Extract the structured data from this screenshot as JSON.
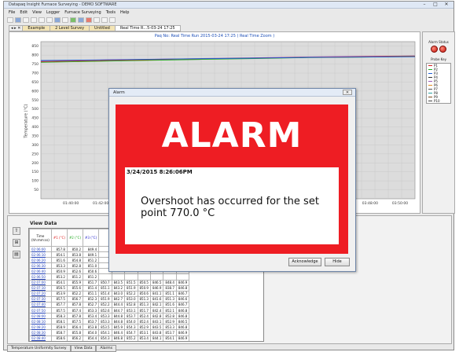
{
  "window": {
    "title": "Datapaq Insight Furnace Surveying - DEMO SOFTWARE",
    "minimize": "–",
    "maximize": "□",
    "close": "✕"
  },
  "menu": [
    "File",
    "Edit",
    "View",
    "Logger",
    "Furnace Surveying",
    "Tools",
    "Help"
  ],
  "tabs": {
    "nav": "◂ ▸ ✕",
    "items": [
      "Example",
      "2 Level Survey",
      "Untitled",
      "Real Time R...5-03-24 17:25"
    ]
  },
  "chart": {
    "title": "Paq No: Real Time Run 2015-03-24 17:25 ( Real Time Zoom )",
    "ylabel": "Temperature (°C)",
    "y_ticks": [
      "850",
      "800",
      "750",
      "700",
      "650",
      "600",
      "550",
      "500",
      "450",
      "400",
      "350",
      "300",
      "250",
      "200",
      "150",
      "100",
      "50"
    ],
    "x_ticks": [
      "01:40:00",
      "01:42:00",
      "01:44:00",
      "03:48:00",
      "03:50:00"
    ]
  },
  "chart_data": {
    "type": "line",
    "ylabel": "Temperature (°C)",
    "ylim": [
      0,
      875
    ],
    "grid": true,
    "series": [
      {
        "color": "#9b59b6",
        "values": [
          768,
          772,
          776,
          781,
          785,
          790,
          793,
          796
        ]
      },
      {
        "color": "#d22222",
        "values": [
          764,
          769,
          774,
          779,
          784,
          788,
          791,
          794
        ]
      },
      {
        "color": "#22aa22",
        "values": [
          760,
          765,
          771,
          776,
          781,
          786,
          789,
          792
        ]
      },
      {
        "color": "#1f5fd6",
        "values": [
          770,
          773,
          777,
          780,
          783,
          787,
          789,
          791
        ]
      }
    ]
  },
  "right_panel": {
    "alarm_status": "Alarm Status",
    "probe_key_title": "Probe Key",
    "probes": [
      "P1",
      "P2",
      "P3",
      "P4",
      "P5",
      "P6",
      "P7",
      "P8",
      "P9",
      "P10"
    ],
    "colors": [
      "#d22222",
      "#22aa22",
      "#1f5fd6",
      "#333333",
      "#9b59b6",
      "#e08a1e",
      "#555555",
      "#2aa0a0",
      "#7a4a20",
      "#444444"
    ]
  },
  "view_data": {
    "title": "View Data",
    "side_tools": [
      "⇧",
      "⊞",
      "▤"
    ],
    "headers": [
      "Time\n(hh:mm:ss)",
      "#1 (°C)",
      "#2 (°C)",
      "#3 (°C)"
    ],
    "rows": [
      [
        "02:06:00",
        "857.8",
        "850.2",
        "849.4",
        "",
        "",
        "",
        "",
        "",
        "",
        ""
      ],
      [
        "02:06:10",
        "854.1",
        "853.8",
        "849.1",
        "",
        "",
        "",
        "",
        "",
        "",
        ""
      ],
      [
        "02:06:20",
        "851.6",
        "854.8",
        "851.2",
        "",
        "",
        "",
        "",
        "",
        "",
        ""
      ],
      [
        "02:06:30",
        "853.3",
        "852.8",
        "851.0",
        "",
        "",
        "",
        "",
        "",
        "",
        ""
      ],
      [
        "02:06:40",
        "850.9",
        "852.6",
        "850.6",
        "",
        "",
        "",
        "",
        "",
        "",
        ""
      ],
      [
        "02:06:50",
        "853.2",
        "851.2",
        "851.2",
        "",
        "",
        "",
        "",
        "",
        "",
        ""
      ],
      [
        "02:07:00",
        "854.1",
        "855.9",
        "851.7",
        "850.7",
        "843.5",
        "851.5",
        "850.5",
        "846.5",
        "848.4",
        "846.9"
      ],
      [
        "02:07:10",
        "856.5",
        "855.6",
        "851.4",
        "851.1",
        "843.2",
        "851.9",
        "850.9",
        "846.9",
        "838.7",
        "846.8"
      ],
      [
        "02:07:20",
        "853.9",
        "852.2",
        "851.1",
        "851.4",
        "843.0",
        "852.2",
        "850.6",
        "841.1",
        "851.1",
        "846.7"
      ],
      [
        "02:07:30",
        "857.5",
        "856.7",
        "852.3",
        "851.9",
        "842.7",
        "853.0",
        "851.3",
        "841.6",
        "851.3",
        "846.6"
      ],
      [
        "02:07:40",
        "857.7",
        "857.8",
        "852.7",
        "852.2",
        "844.4",
        "852.8",
        "851.3",
        "842.1",
        "851.6",
        "846.7"
      ],
      [
        "02:07:50",
        "857.5",
        "857.4",
        "853.3",
        "852.6",
        "844.7",
        "853.1",
        "851.7",
        "842.4",
        "852.1",
        "846.8"
      ],
      [
        "02:08:00",
        "858.3",
        "857.8",
        "853.4",
        "853.3",
        "844.8",
        "853.7",
        "852.4",
        "842.8",
        "852.8",
        "846.8"
      ],
      [
        "02:08:10",
        "858.1",
        "857.5",
        "853.7",
        "853.3",
        "844.8",
        "854.0",
        "852.4",
        "843.1",
        "852.9",
        "846.5"
      ],
      [
        "02:08:20",
        "858.9",
        "856.4",
        "853.8",
        "853.5",
        "845.9",
        "854.3",
        "852.9",
        "843.5",
        "853.3",
        "846.8"
      ],
      [
        "02:08:30",
        "858.7",
        "855.8",
        "854.0",
        "854.1",
        "846.4",
        "854.7",
        "853.1",
        "843.8",
        "853.7",
        "846.9"
      ],
      [
        "02:08:40",
        "858.6",
        "856.2",
        "854.4",
        "854.3",
        "846.8",
        "855.2",
        "853.4",
        "844.1",
        "854.1",
        "846.9"
      ],
      [
        "02:08:50",
        "858.8",
        "856.6",
        "854.6",
        "854.5",
        "847.0",
        "855.4",
        "853.6",
        "844.3",
        "854.3",
        "847.0"
      ]
    ]
  },
  "status_tabs": [
    "Temperature Uniformity Survey",
    "View Data",
    "Alarms"
  ],
  "dialog": {
    "title": "Alarm",
    "close": "✕",
    "heading": "ALARM",
    "timestamp": "3/24/2015 8:26:06PM",
    "message": "Overshoot has occurred for the set point 770.0 °C",
    "acknowledge_label": "Acknowledge",
    "hide_label": "Hide",
    "bg_color": "#ee1d23"
  }
}
